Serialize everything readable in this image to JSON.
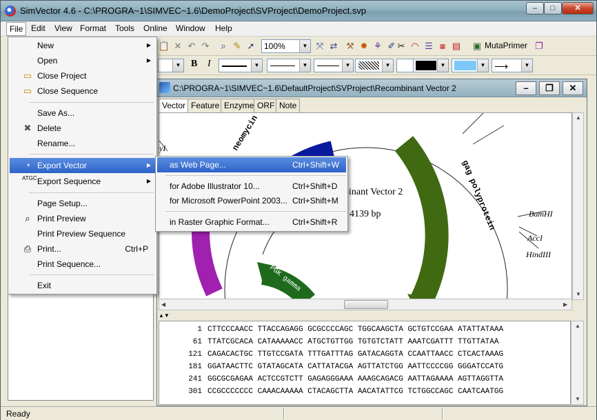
{
  "window": {
    "title": "SimVector 4.6 - C:\\PROGRA~1\\SIMVEC~1.6\\DemoProject\\SVProject\\DemoProject.svp",
    "min": "–",
    "max": "□",
    "close": "✕"
  },
  "menubar": [
    "File",
    "Edit",
    "View",
    "Format",
    "Tools",
    "Online",
    "Window",
    "Help"
  ],
  "toolbar": {
    "zoom": "100%",
    "mutaprimer": "MutaPrimer",
    "bold": "B",
    "italic": "I"
  },
  "child_window": {
    "title": "C:\\PROGRA~1\\SIMVEC~1.6\\DefaultProject\\SVProject\\Recombinant Vector 2",
    "tabs": [
      "Vector",
      "Feature",
      "Enzyme",
      "ORF",
      "Note"
    ],
    "active_tab": "Vector"
  },
  "map": {
    "name": "Recombinant Vector 2",
    "name_visible": "binant Vector 2",
    "size_visible": "4139 bp",
    "labels": {
      "neomycin": "neomycin P",
      "gag": "gag polyprotein",
      "bamhi": "BamHI",
      "acci": "AccI",
      "hindiii": "HindIII",
      "psk": "PGK gamma",
      "left_cut": "yI"
    },
    "colors": {
      "blue": "#0a1a9e",
      "green": "#3f6a12",
      "dark_green": "#1d6a1d",
      "magenta": "#a020b0"
    }
  },
  "sequence": [
    {
      "num": "1",
      "seq": "CTTCCCAACC TTACCAGAGG GCGCCCCAGC TGGCAAGCTA GCTGTCCGAA ATATTATAAA"
    },
    {
      "num": "61",
      "seq": "TTATCGCACA CATAAAAACC ATGCTGTTGG TGTGTCTATT AAATCGATTT TTGTTATAA"
    },
    {
      "num": "121",
      "seq": "CAGACACTGC TTGTCCGATA TTTGATTTAG GATACAGGTA CCAATTAACC CTCACTAAAG"
    },
    {
      "num": "181",
      "seq": "GGATAACTTC GTATAGCATA CATTATACGA AGTTATCTGG AATTCCCCGG GGGATCCATG"
    },
    {
      "num": "241",
      "seq": "GGCGCGAGAA ACTCCGTCTT GAGAGGGAAA AAAGCAGACG AATTAGAAAA AGTTAGGTTA"
    },
    {
      "num": "301",
      "seq": "CCGCCCCCCC CAAACAAAAA CTACAGCTTA AACATATTCG TCTGGCCAGC CAATCAATGG"
    }
  ],
  "file_menu": {
    "items": [
      {
        "label": "New",
        "sub": "▶"
      },
      {
        "label": "Open",
        "sub": "▶"
      },
      {
        "label": "Close Project"
      },
      {
        "label": "Close Sequence"
      },
      {
        "label": "Save As..."
      },
      {
        "label": "Delete"
      },
      {
        "label": "Rename..."
      },
      {
        "label": "Export Vector",
        "sub": "▶"
      },
      {
        "label": "Export Sequence",
        "sub": "▶"
      },
      {
        "label": "Page Setup..."
      },
      {
        "label": "Print Preview"
      },
      {
        "label": "Print Preview Sequence"
      },
      {
        "label": "Print...",
        "shortcut": "Ctrl+P"
      },
      {
        "label": "Print Sequence..."
      },
      {
        "label": "Exit"
      }
    ]
  },
  "export_submenu": [
    {
      "label": "as Web Page...",
      "shortcut": "Ctrl+Shift+W"
    },
    {
      "label": "for Adobe Illustrator 10...",
      "shortcut": "Ctrl+Shift+D"
    },
    {
      "label": "for Microsoft PowerPoint 2003...",
      "shortcut": "Ctrl+Shift+M"
    },
    {
      "label": "in Raster Graphic Format...",
      "shortcut": "Ctrl+Shift+R"
    }
  ],
  "status": {
    "text": "Ready"
  }
}
